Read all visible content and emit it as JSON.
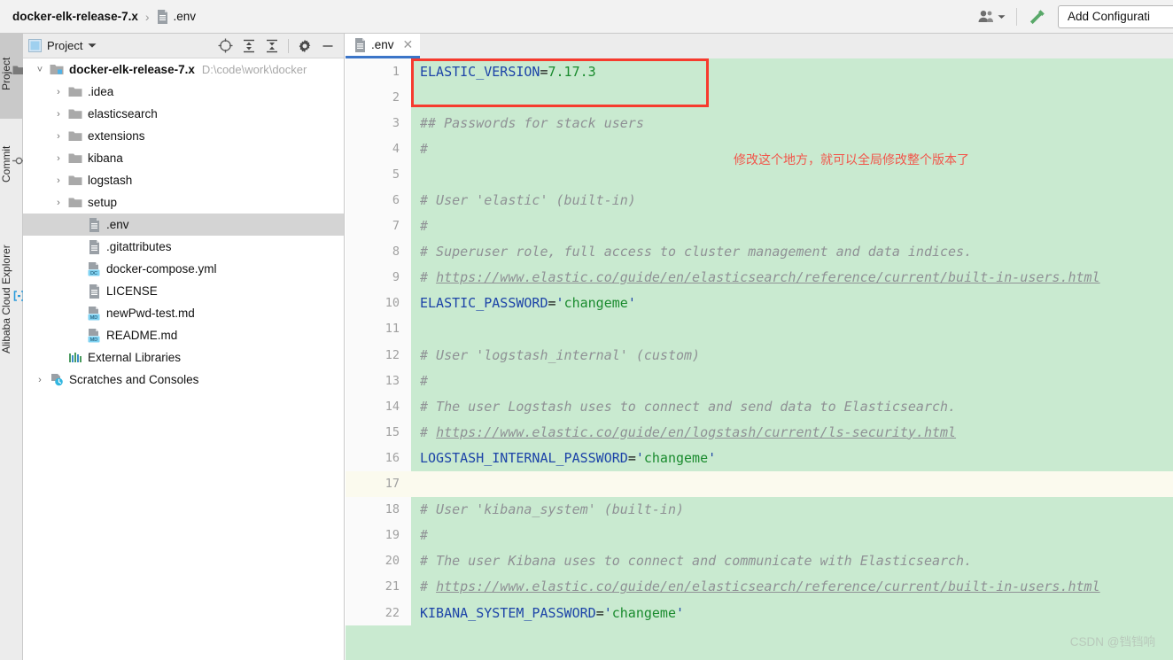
{
  "breadcrumb": {
    "root": "docker-elk-release-7.x",
    "separator": "›",
    "file": ".env",
    "file_icon": "file-icon"
  },
  "topbar": {
    "people_icon": "people-icon",
    "people_dropdown_icon": "chevron-down-icon",
    "build_icon": "hammer-icon",
    "add_configuration_label": "Add Configurati"
  },
  "toolstrip": {
    "tabs": [
      {
        "label": "Project",
        "icon": "folder-icon",
        "active": true
      },
      {
        "label": "Commit",
        "icon": "commit-icon",
        "active": false
      },
      {
        "label": "Alibaba Cloud Explorer",
        "icon": "cloud-bracket-icon",
        "active": false
      }
    ]
  },
  "project_panel": {
    "title": "Project",
    "title_dropdown_icon": "chevron-down-icon",
    "tools": [
      {
        "name": "locate-icon"
      },
      {
        "name": "expand-all-icon"
      },
      {
        "name": "collapse-all-icon"
      },
      {
        "name": "settings-gear-icon"
      },
      {
        "name": "minimize-icon"
      }
    ],
    "tree": [
      {
        "label": "docker-elk-release-7.x",
        "path": "D:\\code\\work\\docker",
        "icon": "module-folder-icon",
        "chevron": "expanded",
        "indent": 0,
        "bold": true,
        "selected": false
      },
      {
        "label": ".idea",
        "icon": "folder-icon",
        "chevron": "collapsed",
        "indent": 1,
        "bold": false,
        "selected": false
      },
      {
        "label": "elasticsearch",
        "icon": "folder-icon",
        "chevron": "collapsed",
        "indent": 1,
        "bold": false,
        "selected": false
      },
      {
        "label": "extensions",
        "icon": "folder-icon",
        "chevron": "collapsed",
        "indent": 1,
        "bold": false,
        "selected": false
      },
      {
        "label": "kibana",
        "icon": "folder-icon",
        "chevron": "collapsed",
        "indent": 1,
        "bold": false,
        "selected": false
      },
      {
        "label": "logstash",
        "icon": "folder-icon",
        "chevron": "collapsed",
        "indent": 1,
        "bold": false,
        "selected": false
      },
      {
        "label": "setup",
        "icon": "folder-icon",
        "chevron": "collapsed",
        "indent": 1,
        "bold": false,
        "selected": false
      },
      {
        "label": ".env",
        "icon": "file-icon",
        "chevron": "none",
        "indent": 2,
        "bold": false,
        "selected": true
      },
      {
        "label": ".gitattributes",
        "icon": "file-icon",
        "chevron": "none",
        "indent": 2,
        "bold": false,
        "selected": false
      },
      {
        "label": "docker-compose.yml",
        "icon": "docker-compose-file-icon",
        "chevron": "none",
        "indent": 2,
        "bold": false,
        "selected": false
      },
      {
        "label": "LICENSE",
        "icon": "file-icon",
        "chevron": "none",
        "indent": 2,
        "bold": false,
        "selected": false
      },
      {
        "label": "newPwd-test.md",
        "icon": "markdown-file-icon",
        "chevron": "none",
        "indent": 2,
        "bold": false,
        "selected": false
      },
      {
        "label": "README.md",
        "icon": "markdown-file-icon",
        "chevron": "none",
        "indent": 2,
        "bold": false,
        "selected": false
      },
      {
        "label": "External Libraries",
        "icon": "libraries-icon",
        "chevron": "none",
        "indent": 1,
        "bold": false,
        "selected": false
      },
      {
        "label": "Scratches and Consoles",
        "icon": "scratches-icon",
        "chevron": "collapsed",
        "indent": 0,
        "bold": false,
        "selected": false
      }
    ]
  },
  "editor": {
    "tab": {
      "label": ".env",
      "icon": "file-icon",
      "close_icon": "close-icon"
    },
    "caret_line": 17,
    "lines": [
      {
        "n": 1,
        "segments": [
          {
            "t": "kw",
            "s": "ELASTIC_VERSION"
          },
          {
            "t": "eq",
            "s": "="
          },
          {
            "t": "val",
            "s": "7.17.3"
          }
        ]
      },
      {
        "n": 2,
        "segments": []
      },
      {
        "n": 3,
        "segments": [
          {
            "t": "cm",
            "s": "## Passwords for stack users"
          }
        ]
      },
      {
        "n": 4,
        "segments": [
          {
            "t": "cm",
            "s": "#"
          }
        ]
      },
      {
        "n": 5,
        "segments": []
      },
      {
        "n": 6,
        "segments": [
          {
            "t": "cm",
            "s": "# User 'elastic' (built-in)"
          }
        ]
      },
      {
        "n": 7,
        "segments": [
          {
            "t": "cm",
            "s": "#"
          }
        ]
      },
      {
        "n": 8,
        "segments": [
          {
            "t": "cm",
            "s": "# Superuser role, full access to cluster management and data indices."
          }
        ]
      },
      {
        "n": 9,
        "segments": [
          {
            "t": "cm",
            "s": "# "
          },
          {
            "t": "link",
            "s": "https://www.elastic.co/guide/en/elasticsearch/reference/current/built-in-users.html"
          }
        ]
      },
      {
        "n": 10,
        "segments": [
          {
            "t": "kw",
            "s": "ELASTIC_PASSWORD"
          },
          {
            "t": "eq",
            "s": "="
          },
          {
            "t": "quo",
            "s": "'"
          },
          {
            "t": "val",
            "s": "changeme"
          },
          {
            "t": "quo",
            "s": "'"
          }
        ]
      },
      {
        "n": 11,
        "segments": []
      },
      {
        "n": 12,
        "segments": [
          {
            "t": "cm",
            "s": "# User 'logstash_internal' (custom)"
          }
        ]
      },
      {
        "n": 13,
        "segments": [
          {
            "t": "cm",
            "s": "#"
          }
        ]
      },
      {
        "n": 14,
        "segments": [
          {
            "t": "cm",
            "s": "# The user Logstash uses to connect and send data to Elasticsearch."
          }
        ]
      },
      {
        "n": 15,
        "segments": [
          {
            "t": "cm",
            "s": "# "
          },
          {
            "t": "link",
            "s": "https://www.elastic.co/guide/en/logstash/current/ls-security.html"
          }
        ]
      },
      {
        "n": 16,
        "segments": [
          {
            "t": "kw",
            "s": "LOGSTASH_INTERNAL_PASSWORD"
          },
          {
            "t": "eq",
            "s": "="
          },
          {
            "t": "quo",
            "s": "'"
          },
          {
            "t": "val",
            "s": "changeme"
          },
          {
            "t": "quo",
            "s": "'"
          }
        ]
      },
      {
        "n": 17,
        "segments": []
      },
      {
        "n": 18,
        "segments": [
          {
            "t": "cm",
            "s": "# User 'kibana_system' (built-in)"
          }
        ]
      },
      {
        "n": 19,
        "segments": [
          {
            "t": "cm",
            "s": "#"
          }
        ]
      },
      {
        "n": 20,
        "segments": [
          {
            "t": "cm",
            "s": "# The user Kibana uses to connect and communicate with Elasticsearch."
          }
        ]
      },
      {
        "n": 21,
        "segments": [
          {
            "t": "cm",
            "s": "# "
          },
          {
            "t": "link",
            "s": "https://www.elastic.co/guide/en/elasticsearch/reference/current/built-in-users.html"
          }
        ]
      },
      {
        "n": 22,
        "segments": [
          {
            "t": "kw",
            "s": "KIBANA_SYSTEM_PASSWORD"
          },
          {
            "t": "eq",
            "s": "="
          },
          {
            "t": "quo",
            "s": "'"
          },
          {
            "t": "val",
            "s": "changeme"
          },
          {
            "t": "quo",
            "s": "'"
          }
        ]
      }
    ]
  },
  "annotations": {
    "highlight_box_color": "#f63b2e",
    "note_text": "修改这个地方，就可以全局修改整个版本了",
    "note_color": "#f2554a",
    "watermark": "CSDN @铛铛响"
  },
  "colors": {
    "editor_background": "#c9ead0",
    "caret_line": "#fbfaee",
    "tab_accent": "#3b75c8",
    "selection": "#d4d4d4"
  }
}
